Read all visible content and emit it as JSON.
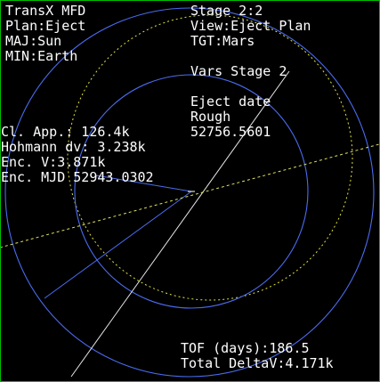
{
  "mfd": {
    "title": "TransX MFD",
    "plan": "Plan:Eject",
    "maj": "MAJ:Sun",
    "min": "MIN:Earth",
    "stage": "Stage 2:2",
    "view": "View:Eject Plan",
    "tgt": "TGT:Mars",
    "vars_stage": "Vars Stage 2",
    "eject_date_label": "Eject date",
    "eject_date_mode": "Rough",
    "eject_date_value": "52756.5601",
    "cl_app": "Cl. App.: 126.4k",
    "hohmann_dv": "Hohmann dv: 3.238k",
    "enc_v": "Enc. V:3.871k",
    "enc_mjd": "Enc. MJD 52943.0302",
    "tof": "TOF (days):186.5",
    "total_dv": "Total DeltaV:4.171k"
  },
  "colors": {
    "background": "#000000",
    "frame": "#00c000",
    "text": "#ffffff",
    "orbit": "#4a6cf0",
    "target_orbit": "#e0e040",
    "line": "#e8e8e8",
    "dotted_line": "#e0e060"
  }
}
